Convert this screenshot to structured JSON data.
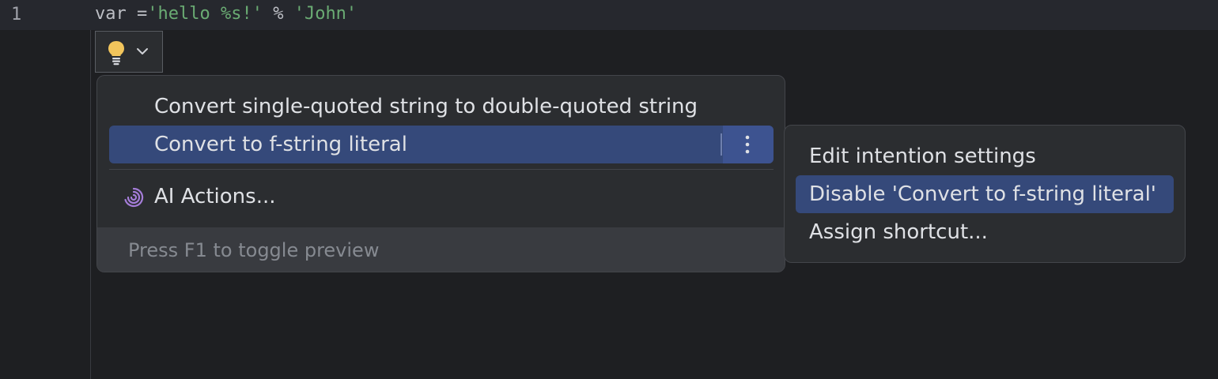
{
  "editor": {
    "line_number": "1",
    "code": {
      "keyword": "var",
      "operator": " =",
      "string1": "'hello %s!'",
      "operator2": " % ",
      "string2": "'John'"
    }
  },
  "intention_popup": {
    "items": [
      {
        "label": "Convert single-quoted string to double-quoted string"
      },
      {
        "label": "Convert to f-string literal",
        "selected": true
      },
      {
        "label": "AI Actions...",
        "icon": "ai-spiral-icon"
      }
    ],
    "footer_hint": "Press F1 to toggle preview"
  },
  "submenu": {
    "items": [
      {
        "label": "Edit intention settings"
      },
      {
        "label": "Disable 'Convert to f-string literal'",
        "selected": true
      },
      {
        "label": "Assign shortcut..."
      }
    ]
  },
  "colors": {
    "background": "#1e1f22",
    "popup_background": "#2b2d30",
    "selection": "#35497a",
    "string": "#6aab73",
    "bulb": "#f2c55c",
    "ai_icon": "#a57dd9"
  }
}
